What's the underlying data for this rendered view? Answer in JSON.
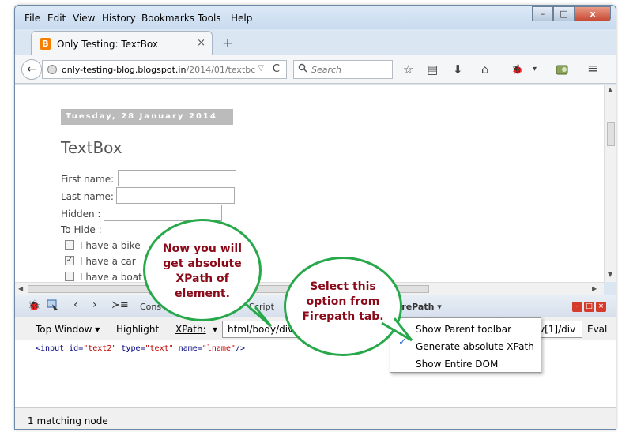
{
  "menu": [
    "File",
    "Edit",
    "View",
    "History",
    "Bookmarks",
    "Tools",
    "Help"
  ],
  "window_buttons": {
    "minimize": "–",
    "maximize": "□",
    "close": "x"
  },
  "tab": {
    "icon": "B",
    "title": "Only Testing: TextBox",
    "close": "×",
    "new_tab": "+"
  },
  "nav": {
    "back": "←",
    "url_host": "only-testing-blog.blogspot.in",
    "url_path": "/2014/01/textbc",
    "url_drop": "▽",
    "reload": "C",
    "search_icon": "🔍",
    "search_placeholder": "Search"
  },
  "toolbar_icons": {
    "bookmark": "☆",
    "reading": "▤",
    "download": "⬇",
    "home": "⌂",
    "firebug": "🐞",
    "firebug_drop": "▾",
    "menu": "≡"
  },
  "page": {
    "date": "Tuesday, 28 January 2014",
    "title": "TextBox",
    "first_name": "First name:",
    "last_name": "Last name:",
    "hidden": "Hidden :",
    "to_hide": "To Hide :",
    "bike": "I have a bike",
    "car": "I have a car",
    "boat": "I have a boat"
  },
  "firebug_tabs": {
    "console": "Cons",
    "script": "Script",
    "firepath": "FirePath ▾",
    "close_controls": [
      "–",
      "□",
      "×"
    ]
  },
  "firepath_toolbar": {
    "top_window": "Top Window",
    "top_window_arrow": "▾",
    "highlight": "Highlight",
    "xpath_label": "XPath:",
    "xpath_arrow": "▾",
    "xpath_value": "html/body/div[3",
    "xpath_tail": "v[1]/div",
    "eval": "Eval"
  },
  "panel": {
    "code_tag_open": "<input",
    "attr1": "id=",
    "val1": "\"text2\"",
    "attr2": "type=",
    "val2": "\"text\"",
    "attr3": "name=",
    "val3": "\"lname\"",
    "code_tag_close": "/>"
  },
  "status": "1 matching node",
  "popup": {
    "items": [
      "Show Parent toolbar",
      "Generate absolute XPath",
      "Show Entire DOM"
    ],
    "checked_index": 1,
    "check": "✓"
  },
  "callouts": {
    "left": "Now you will get absolute XPath of element.",
    "right": "Select this option from Firepath tab."
  },
  "colors": {
    "callout_border": "#27a84a",
    "callout_text": "#8b0a1a",
    "date_bg": "#bbbbbb"
  }
}
